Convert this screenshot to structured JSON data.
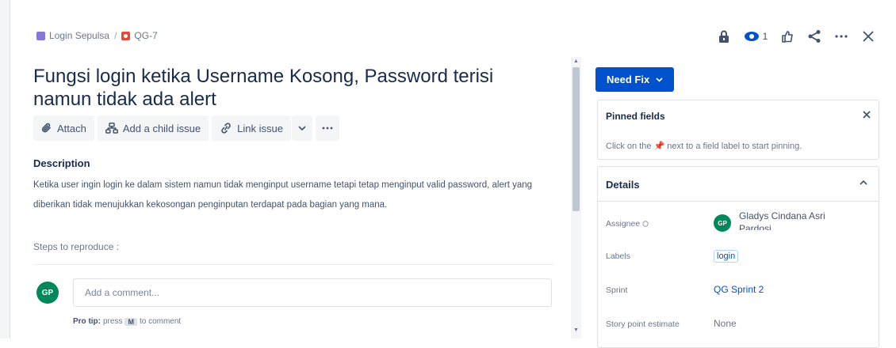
{
  "breadcrumb": {
    "project": "Login Sepulsa",
    "separator": "/",
    "issue_key": "QG-7"
  },
  "header": {
    "watch_count": "1"
  },
  "issue": {
    "title": "Fungsi login ketika Username Kosong, Password terisi namun tidak ada alert",
    "toolbar": {
      "attach": "Attach",
      "add_child": "Add a child issue",
      "link_issue": "Link issue"
    },
    "description_heading": "Description",
    "description_text": "Ketika user ingin login ke dalam sistem namun tidak menginput username tetapi tetap menginput valid password, alert yang diberikan tidak menujukkan kekosongan penginputan terdapat pada bagian yang mana.",
    "steps": "Steps to reproduce :"
  },
  "comment": {
    "avatar_initials": "GP",
    "placeholder": "Add a comment...",
    "pro_tip_label": "Pro tip:",
    "pro_tip_text_before": "press",
    "pro_tip_key": "M",
    "pro_tip_text_after": "to comment"
  },
  "status": {
    "label": "Need Fix"
  },
  "pinned": {
    "title": "Pinned fields",
    "hint": "Click on the 📌 next to a field label to start pinning."
  },
  "details": {
    "title": "Details",
    "fields": {
      "assignee_label": "Assignee",
      "assignee_initials": "GP",
      "assignee_value": "Gladys Cindana Asri Pardosi",
      "labels_label": "Labels",
      "labels_value": "login",
      "sprint_label": "Sprint",
      "sprint_value": "QG Sprint 2",
      "story_points_label": "Story point estimate",
      "story_points_value": "None"
    }
  },
  "colors": {
    "primary": "#0052cc",
    "avatar": "#00875a",
    "issue_type": "#e5493a",
    "project": "#8777d9"
  }
}
